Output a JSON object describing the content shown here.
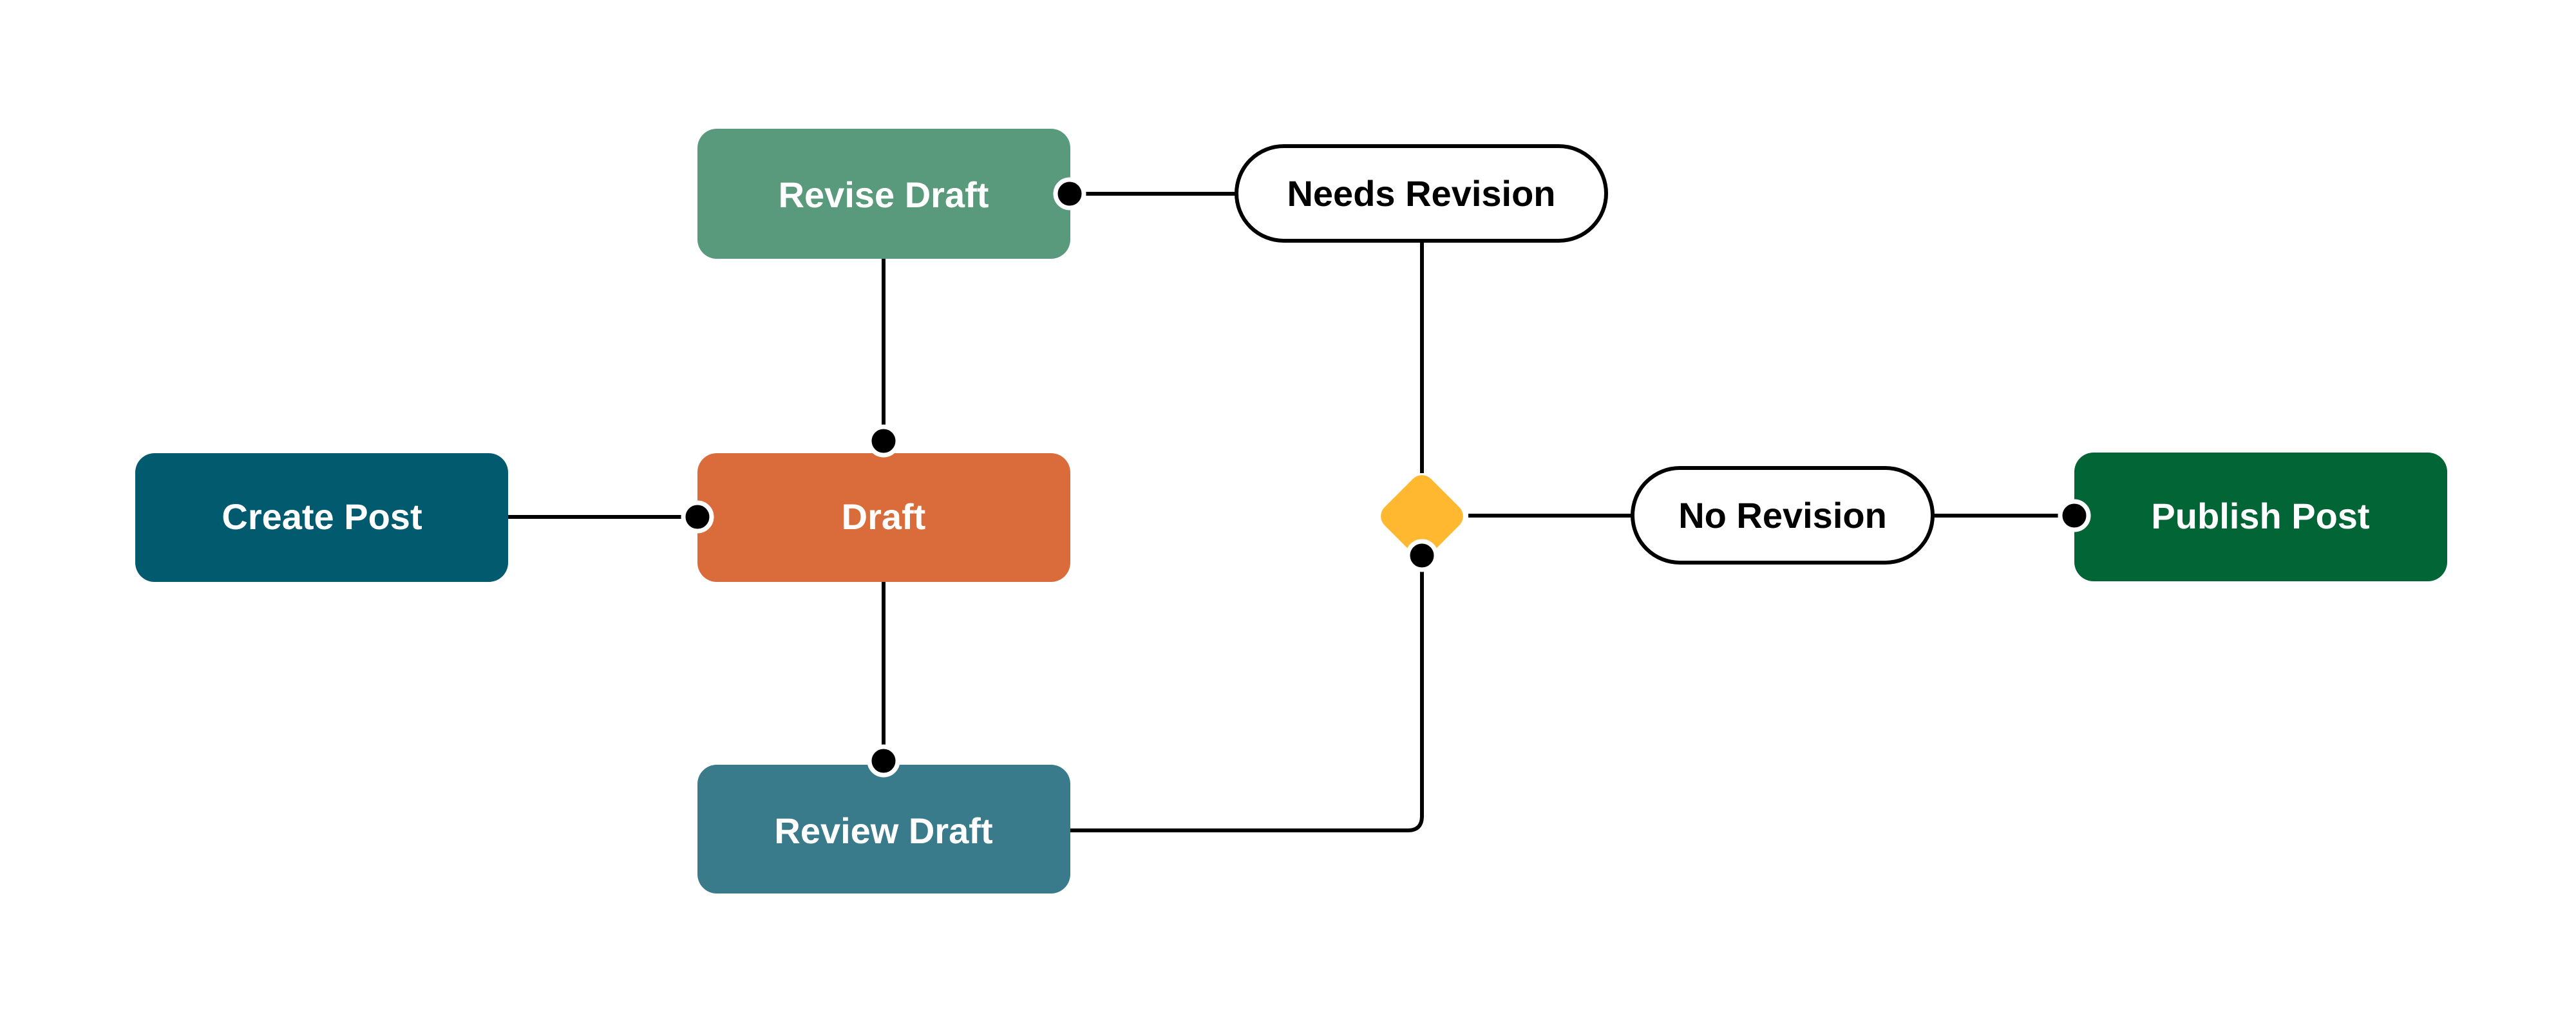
{
  "diagram": {
    "type": "flowchart",
    "nodes": [
      {
        "id": "create-post",
        "label": "Create Post",
        "shape": "rounded-rect",
        "color": "#025a6f"
      },
      {
        "id": "draft",
        "label": "Draft",
        "shape": "rounded-rect",
        "color": "#d96c3a"
      },
      {
        "id": "revise-draft",
        "label": "Revise Draft",
        "shape": "rounded-rect",
        "color": "#5a9a7c"
      },
      {
        "id": "review-draft",
        "label": "Review Draft",
        "shape": "rounded-rect",
        "color": "#3a7b8b"
      },
      {
        "id": "decision",
        "label": "",
        "shape": "diamond",
        "color": "#ffb82f"
      },
      {
        "id": "publish-post",
        "label": "Publish Post",
        "shape": "rounded-rect",
        "color": "#026535"
      }
    ],
    "edge_labels": [
      {
        "id": "needs-revision",
        "label": "Needs Revision"
      },
      {
        "id": "no-revision",
        "label": "No Revision"
      }
    ],
    "edges": [
      {
        "from": "create-post",
        "to": "draft"
      },
      {
        "from": "revise-draft",
        "to": "draft"
      },
      {
        "from": "draft",
        "to": "review-draft"
      },
      {
        "from": "review-draft",
        "to": "decision"
      },
      {
        "from": "decision",
        "to": "revise-draft",
        "label": "Needs Revision"
      },
      {
        "from": "decision",
        "to": "publish-post",
        "label": "No Revision"
      }
    ]
  }
}
